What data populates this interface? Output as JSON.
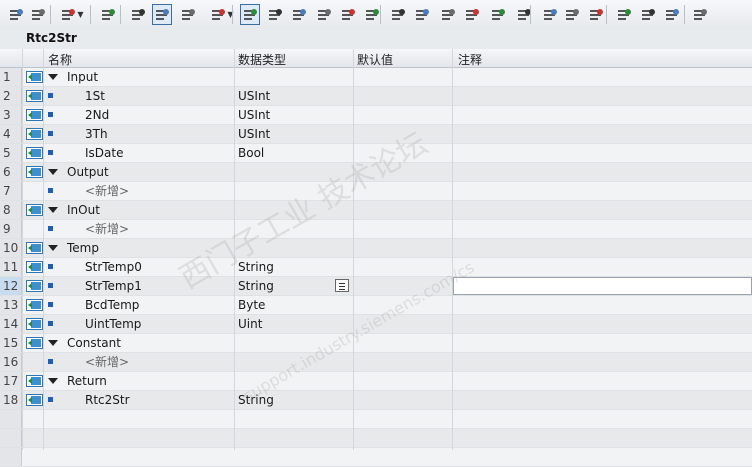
{
  "block_title": "Rtc2Str",
  "columns": {
    "name": "名称",
    "datatype": "数据类型",
    "default": "默认值",
    "comment": "注释"
  },
  "toolbar": [
    {
      "icon": "insert-network-icon"
    },
    {
      "icon": "insert-network-2-icon"
    },
    {
      "icon": "add-line-icon"
    },
    {
      "icon": "reset-icon"
    },
    {
      "icon": "block-interface-icon"
    },
    {
      "icon": "absolute-operands-icon"
    },
    {
      "icon": "favorites-icon"
    },
    {
      "icon": "monitoring-icon"
    },
    {
      "icon": "set-breakpoint-icon"
    },
    {
      "icon": "clear-breakpoint-icon"
    },
    {
      "icon": "goto-network-icon"
    },
    {
      "icon": "goto-previous-icon"
    },
    {
      "icon": "list-icon"
    },
    {
      "icon": "compare-icon"
    },
    {
      "icon": "indent-left-icon"
    },
    {
      "icon": "indent-right-icon"
    },
    {
      "icon": "outdent-icon"
    },
    {
      "icon": "align-icon"
    },
    {
      "icon": "expand-icon"
    },
    {
      "icon": "collapse-icon"
    },
    {
      "icon": "cross-ref-icon"
    },
    {
      "icon": "refresh-icon"
    },
    {
      "icon": "undo-refresh-icon"
    },
    {
      "icon": "search-icon"
    },
    {
      "icon": "monitor-on-icon"
    },
    {
      "icon": "monitor-off-icon"
    },
    {
      "icon": "memory-icon"
    }
  ],
  "rows": [
    {
      "num": "1",
      "kind": "section",
      "name": "Input",
      "type": ""
    },
    {
      "num": "2",
      "kind": "var",
      "name": "1St",
      "type": "USInt"
    },
    {
      "num": "3",
      "kind": "var",
      "name": "2Nd",
      "type": "USInt"
    },
    {
      "num": "4",
      "kind": "var",
      "name": "3Th",
      "type": "USInt"
    },
    {
      "num": "5",
      "kind": "var",
      "name": "IsDate",
      "type": "Bool"
    },
    {
      "num": "6",
      "kind": "section",
      "name": "Output",
      "type": ""
    },
    {
      "num": "7",
      "kind": "add",
      "name": "<新增>",
      "type": ""
    },
    {
      "num": "8",
      "kind": "section",
      "name": "InOut",
      "type": ""
    },
    {
      "num": "9",
      "kind": "add",
      "name": "<新增>",
      "type": ""
    },
    {
      "num": "10",
      "kind": "section",
      "name": "Temp",
      "type": ""
    },
    {
      "num": "11",
      "kind": "var",
      "name": "StrTemp0",
      "type": "String"
    },
    {
      "num": "12",
      "kind": "var",
      "name": "StrTemp1",
      "type": "String",
      "selected": true
    },
    {
      "num": "13",
      "kind": "var",
      "name": "BcdTemp",
      "type": "Byte"
    },
    {
      "num": "14",
      "kind": "var",
      "name": "UintTemp",
      "type": "Uint"
    },
    {
      "num": "15",
      "kind": "section",
      "name": "Constant",
      "type": ""
    },
    {
      "num": "16",
      "kind": "add",
      "name": "<新增>",
      "type": ""
    },
    {
      "num": "17",
      "kind": "section",
      "name": "Return",
      "type": ""
    },
    {
      "num": "18",
      "kind": "var",
      "name": "Rtc2Str",
      "type": "String"
    }
  ],
  "watermark": {
    "line1": "西门子工业  技术论坛",
    "line2": "support.industry.siemens.com/cs"
  },
  "colors": {
    "accent": "#1d5fb8",
    "selection": "#c9dbef",
    "grid": "#d3d6da"
  }
}
